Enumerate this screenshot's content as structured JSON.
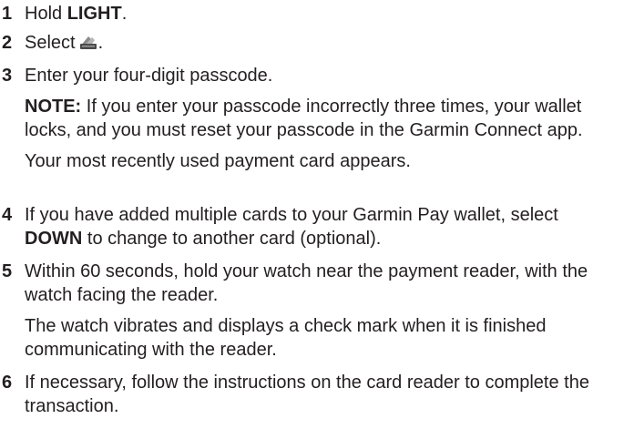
{
  "steps": [
    {
      "number": "1",
      "pre": "Hold ",
      "bold": "LIGHT",
      "post": "."
    },
    {
      "number": "2",
      "pre": "Select",
      "icon": "wallet-icon",
      "post": "."
    },
    {
      "number": "3",
      "text": "Enter your four-digit passcode.",
      "note_label": "NOTE:",
      "note_text": " If you enter your passcode incorrectly three times, your wallet locks, and you must reset your passcode in the Garmin Connect app.",
      "result": "Your most recently used payment card appears."
    },
    {
      "number": "4",
      "pre": "If you have added multiple cards to your Garmin Pay wallet, select ",
      "bold": "DOWN",
      "post": " to change to another card (optional)."
    },
    {
      "number": "5",
      "text": "Within 60 seconds, hold your watch near the payment reader, with the watch facing the reader.",
      "result": "The watch vibrates and displays a check mark when it is finished communicating with the reader."
    },
    {
      "number": "6",
      "text": "If necessary, follow the instructions on the card reader to complete the transaction."
    }
  ]
}
